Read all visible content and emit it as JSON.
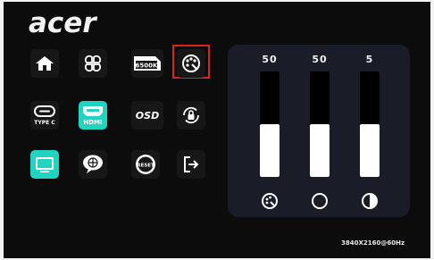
{
  "brand": {
    "logo_text": "acer"
  },
  "menu": {
    "tiles": [
      {
        "name": "home",
        "icon": "home-icon",
        "label": ""
      },
      {
        "name": "quick-menu",
        "icon": "four-leaf-icon",
        "label": ""
      },
      {
        "name": "color-temp",
        "icon": "color-temp-icon",
        "label": "6500K"
      },
      {
        "name": "color-settings",
        "icon": "palette-icon",
        "label": "",
        "selected": true
      },
      {
        "name": "input-type-c",
        "icon": "typec-icon",
        "label": "TYPE C"
      },
      {
        "name": "input-hdmi",
        "icon": "hdmi-icon",
        "label": "HDMI",
        "active": true
      },
      {
        "name": "osd",
        "icon": "osd-icon",
        "label": "OSD"
      },
      {
        "name": "lock",
        "icon": "lock-icon",
        "label": ""
      },
      {
        "name": "display",
        "icon": "monitor-icon",
        "label": "",
        "active": true
      },
      {
        "name": "language",
        "icon": "globe-icon",
        "label": ""
      },
      {
        "name": "reset",
        "icon": "reset-icon",
        "label": "RESET"
      },
      {
        "name": "exit",
        "icon": "exit-icon",
        "label": ""
      }
    ]
  },
  "sliders": [
    {
      "name": "color",
      "value": "50",
      "level": 0.5,
      "icon": "palette-icon"
    },
    {
      "name": "contrast",
      "value": "50",
      "level": 0.5,
      "icon": "contrast-icon"
    },
    {
      "name": "brightness",
      "value": "5",
      "level": 0.5,
      "icon": "brightness-icon"
    }
  ],
  "status": {
    "resolution": "3840X2160@60Hz"
  },
  "colors": {
    "accent": "#20d4bf",
    "selection": "#d8241c",
    "panel": "#1a1d28"
  }
}
